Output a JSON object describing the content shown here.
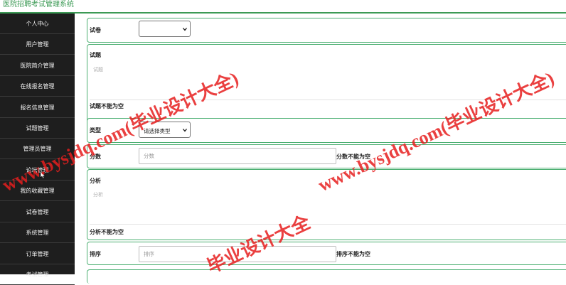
{
  "app": {
    "title": "医院招聘考试管理系统"
  },
  "sidebar": {
    "items": [
      {
        "label": "个人中心"
      },
      {
        "label": "用户管理"
      },
      {
        "label": "医院简介管理"
      },
      {
        "label": "在线报名管理"
      },
      {
        "label": "报名信息管理"
      },
      {
        "label": "试题管理"
      },
      {
        "label": "管理员管理"
      },
      {
        "label": "论坛管理"
      },
      {
        "label": "我的收藏管理"
      },
      {
        "label": "试卷管理"
      },
      {
        "label": "系统管理"
      },
      {
        "label": "订单管理"
      },
      {
        "label": "考试管理"
      }
    ]
  },
  "form": {
    "paper": {
      "label": "试卷",
      "selected": ""
    },
    "question": {
      "label": "试题",
      "placeholder": "试题",
      "error": "试题不能为空"
    },
    "type": {
      "label": "类型",
      "selected": "请选择类型"
    },
    "score": {
      "label": "分数",
      "placeholder": "分数",
      "error": "分数不能为空"
    },
    "analysis": {
      "label": "分析",
      "placeholder": "分析",
      "error": "分析不能为空"
    },
    "sort": {
      "label": "排序",
      "placeholder": "排序",
      "error": "排序不能为空"
    }
  },
  "watermarks": [
    "www.bysjdq.com(毕业设计大全)",
    "www.bysjdq.com(毕业设计大全)",
    "毕业设计大全"
  ],
  "colors": {
    "accent": "#3c9a55",
    "sidebar_bg": "#1e1e1e",
    "panel_border": "#4caf72",
    "watermark": "#e61e1e"
  }
}
